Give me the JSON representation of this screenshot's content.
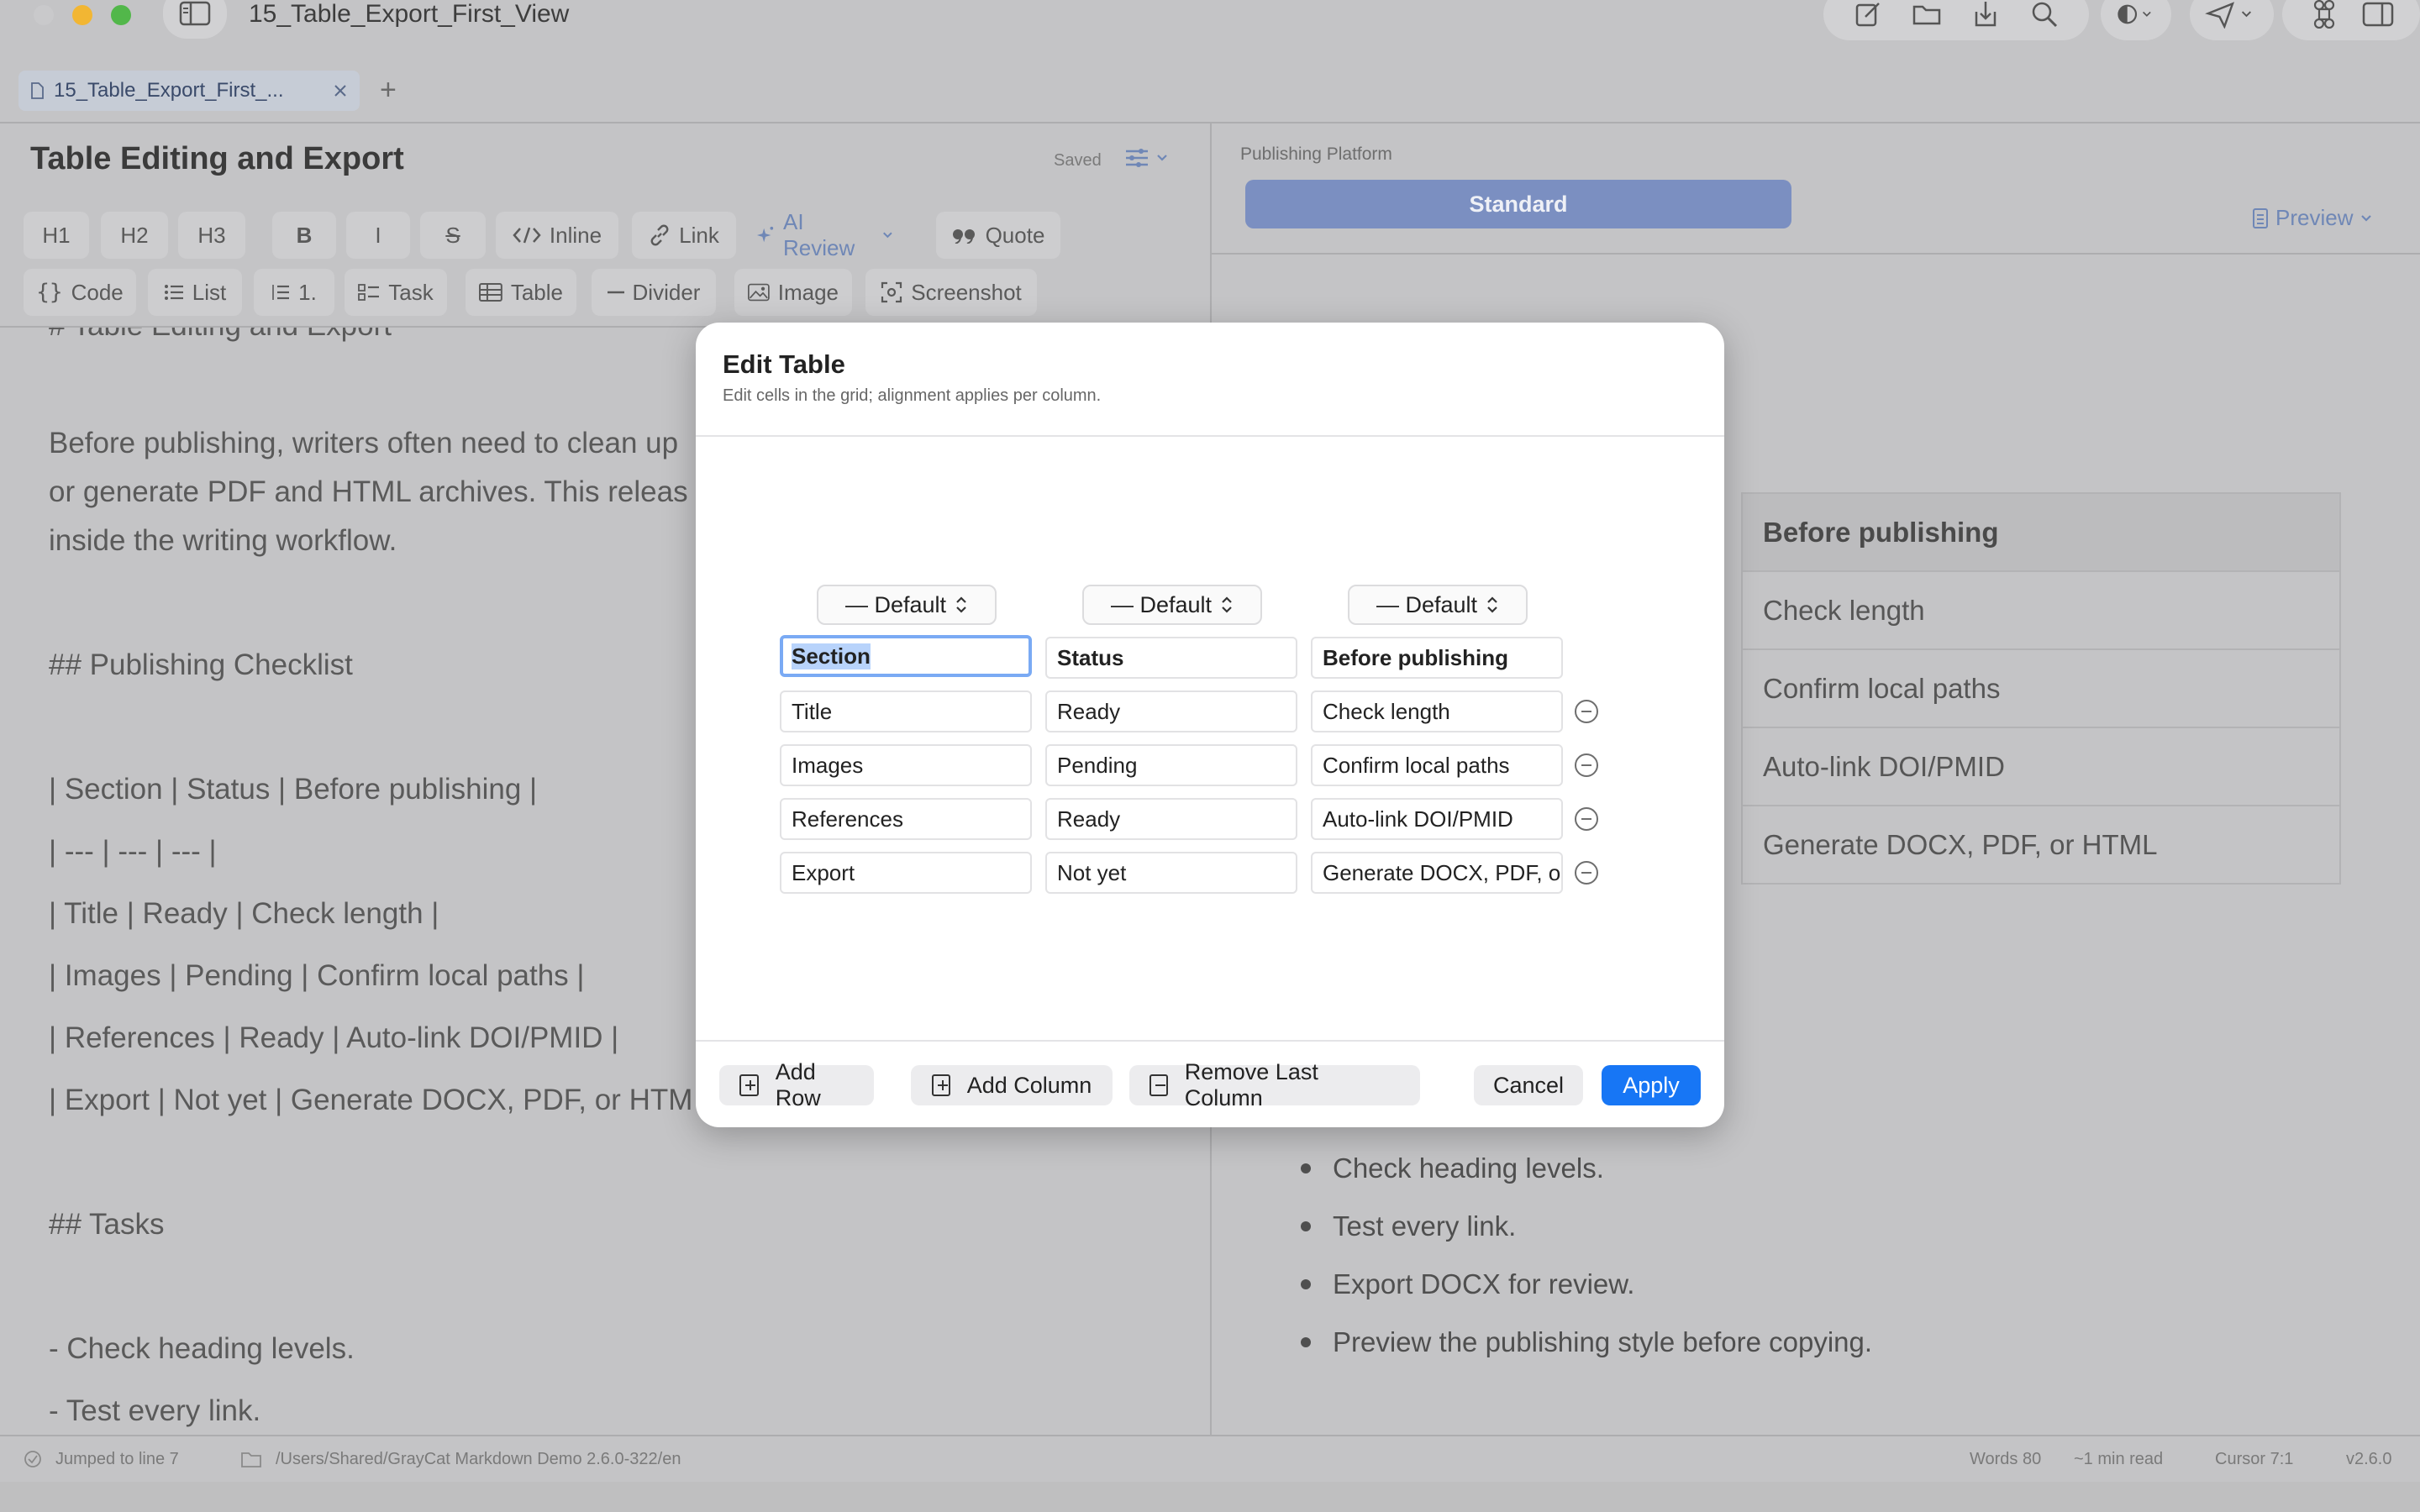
{
  "window": {
    "title": "15_Table_Export_First_View"
  },
  "tabbar": {
    "tab_label": "15_Table_Export_First_...",
    "add_label": "+"
  },
  "editor": {
    "doc_title": "Table Editing and Export",
    "save_status": "Saved",
    "toolbar_row1": [
      "H1",
      "H2",
      "H3",
      "B",
      "I",
      "S",
      "Inline",
      "Link",
      "AI Review",
      "Quote"
    ],
    "toolbar_row2": [
      "Code",
      "List",
      "1.",
      "Task",
      "Table",
      "Divider",
      "Image",
      "Screenshot"
    ],
    "lines": [
      "# Table Editing and Export",
      "Before publishing, writers often need to clean up",
      "or generate PDF and HTML archives. This releas",
      "inside the writing workflow.",
      "## Publishing Checklist",
      "| Section | Status | Before publishing |",
      "| --- | --- | --- |",
      "| Title | Ready | Check length |",
      "| Images | Pending | Confirm local paths |",
      "| References | Ready | Auto-link DOI/PMID |",
      "| Export | Not yet | Generate DOCX, PDF, or HTM",
      "## Tasks",
      "- Check heading levels.",
      "- Test every link."
    ]
  },
  "preview": {
    "platform_label": "Publishing Platform",
    "platform_value": "Standard",
    "preview_button": "Preview",
    "table_header": "Before publishing",
    "table_cells": [
      "Check length",
      "Confirm local paths",
      "Auto-link DOI/PMID",
      "Generate DOCX, PDF, or HTML"
    ],
    "bullets": [
      "Check heading levels.",
      "Test every link.",
      "Export DOCX for review.",
      "Preview the publishing style before copying."
    ]
  },
  "statusbar": {
    "message": "Jumped to line 7",
    "path": "/Users/Shared/GrayCat Markdown Demo 2.6.0-322/en",
    "words": "Words 80",
    "read_time": "~1 min read",
    "cursor": "Cursor 7:1",
    "version": "v2.6.0"
  },
  "dialog": {
    "title": "Edit Table",
    "subtitle": "Edit cells in the grid; alignment applies per column.",
    "alignments": [
      "— Default",
      "— Default",
      "— Default"
    ],
    "header": [
      "Section",
      "Status",
      "Before publishing"
    ],
    "rows": [
      [
        "Title",
        "Ready",
        "Check length"
      ],
      [
        "Images",
        "Pending",
        "Confirm local paths"
      ],
      [
        "References",
        "Ready",
        "Auto-link DOI/PMID"
      ],
      [
        "Export",
        "Not yet",
        "Generate DOCX, PDF, or HTML"
      ]
    ],
    "buttons": {
      "add_row": "Add Row",
      "add_column": "Add Column",
      "remove_column": "Remove Last Column",
      "cancel": "Cancel",
      "apply": "Apply"
    }
  },
  "colors": {
    "accent": "#1776f5",
    "platform_button": "#7b8fc1",
    "focus_ring": "#7aaaf4"
  }
}
